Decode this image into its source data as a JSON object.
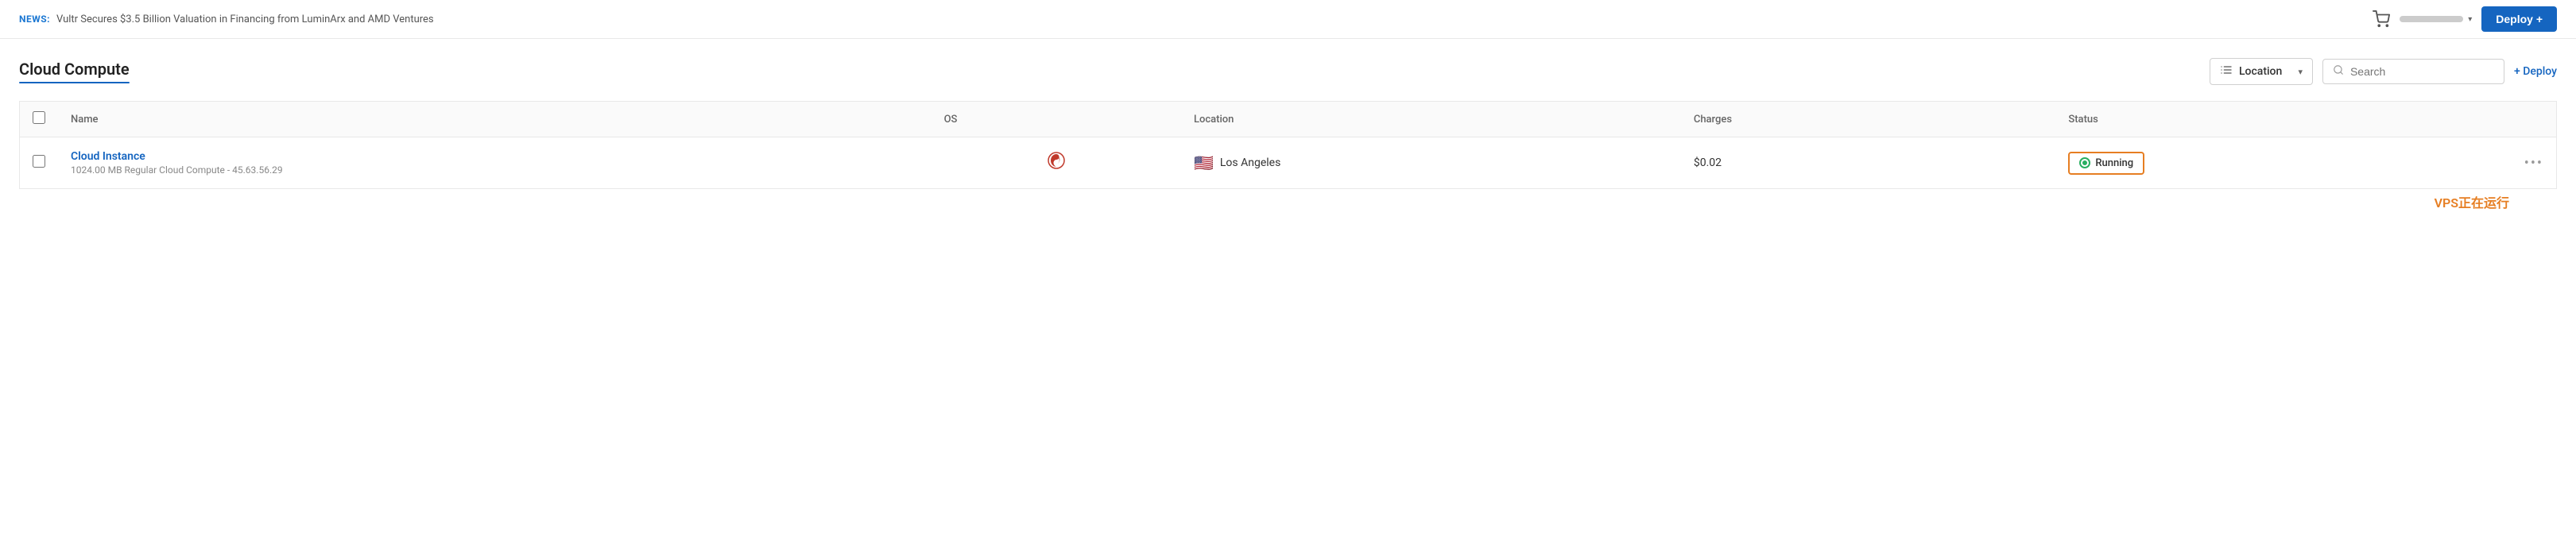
{
  "news": {
    "label": "NEWS:",
    "text": "Vultr Secures $3.5 Billion Valuation in Financing from LuminArx and AMD Ventures"
  },
  "header": {
    "deploy_button_label": "Deploy +",
    "chevron": "▾"
  },
  "page": {
    "title": "Cloud Compute"
  },
  "controls": {
    "location_label": "Location",
    "search_placeholder": "Search",
    "deploy_link_label": "+ Deploy"
  },
  "table": {
    "columns": {
      "name": "Name",
      "os": "OS",
      "location": "Location",
      "charges": "Charges",
      "status": "Status"
    },
    "rows": [
      {
        "name": "Cloud Instance",
        "details": "1024.00 MB Regular Cloud Compute - 45.63.56.29",
        "os_icon": "debian",
        "flag": "🇺🇸",
        "location": "Los Angeles",
        "charges": "$0.02",
        "status": "Running"
      }
    ]
  },
  "annotation": {
    "vps_running": "VPS正在运行"
  }
}
